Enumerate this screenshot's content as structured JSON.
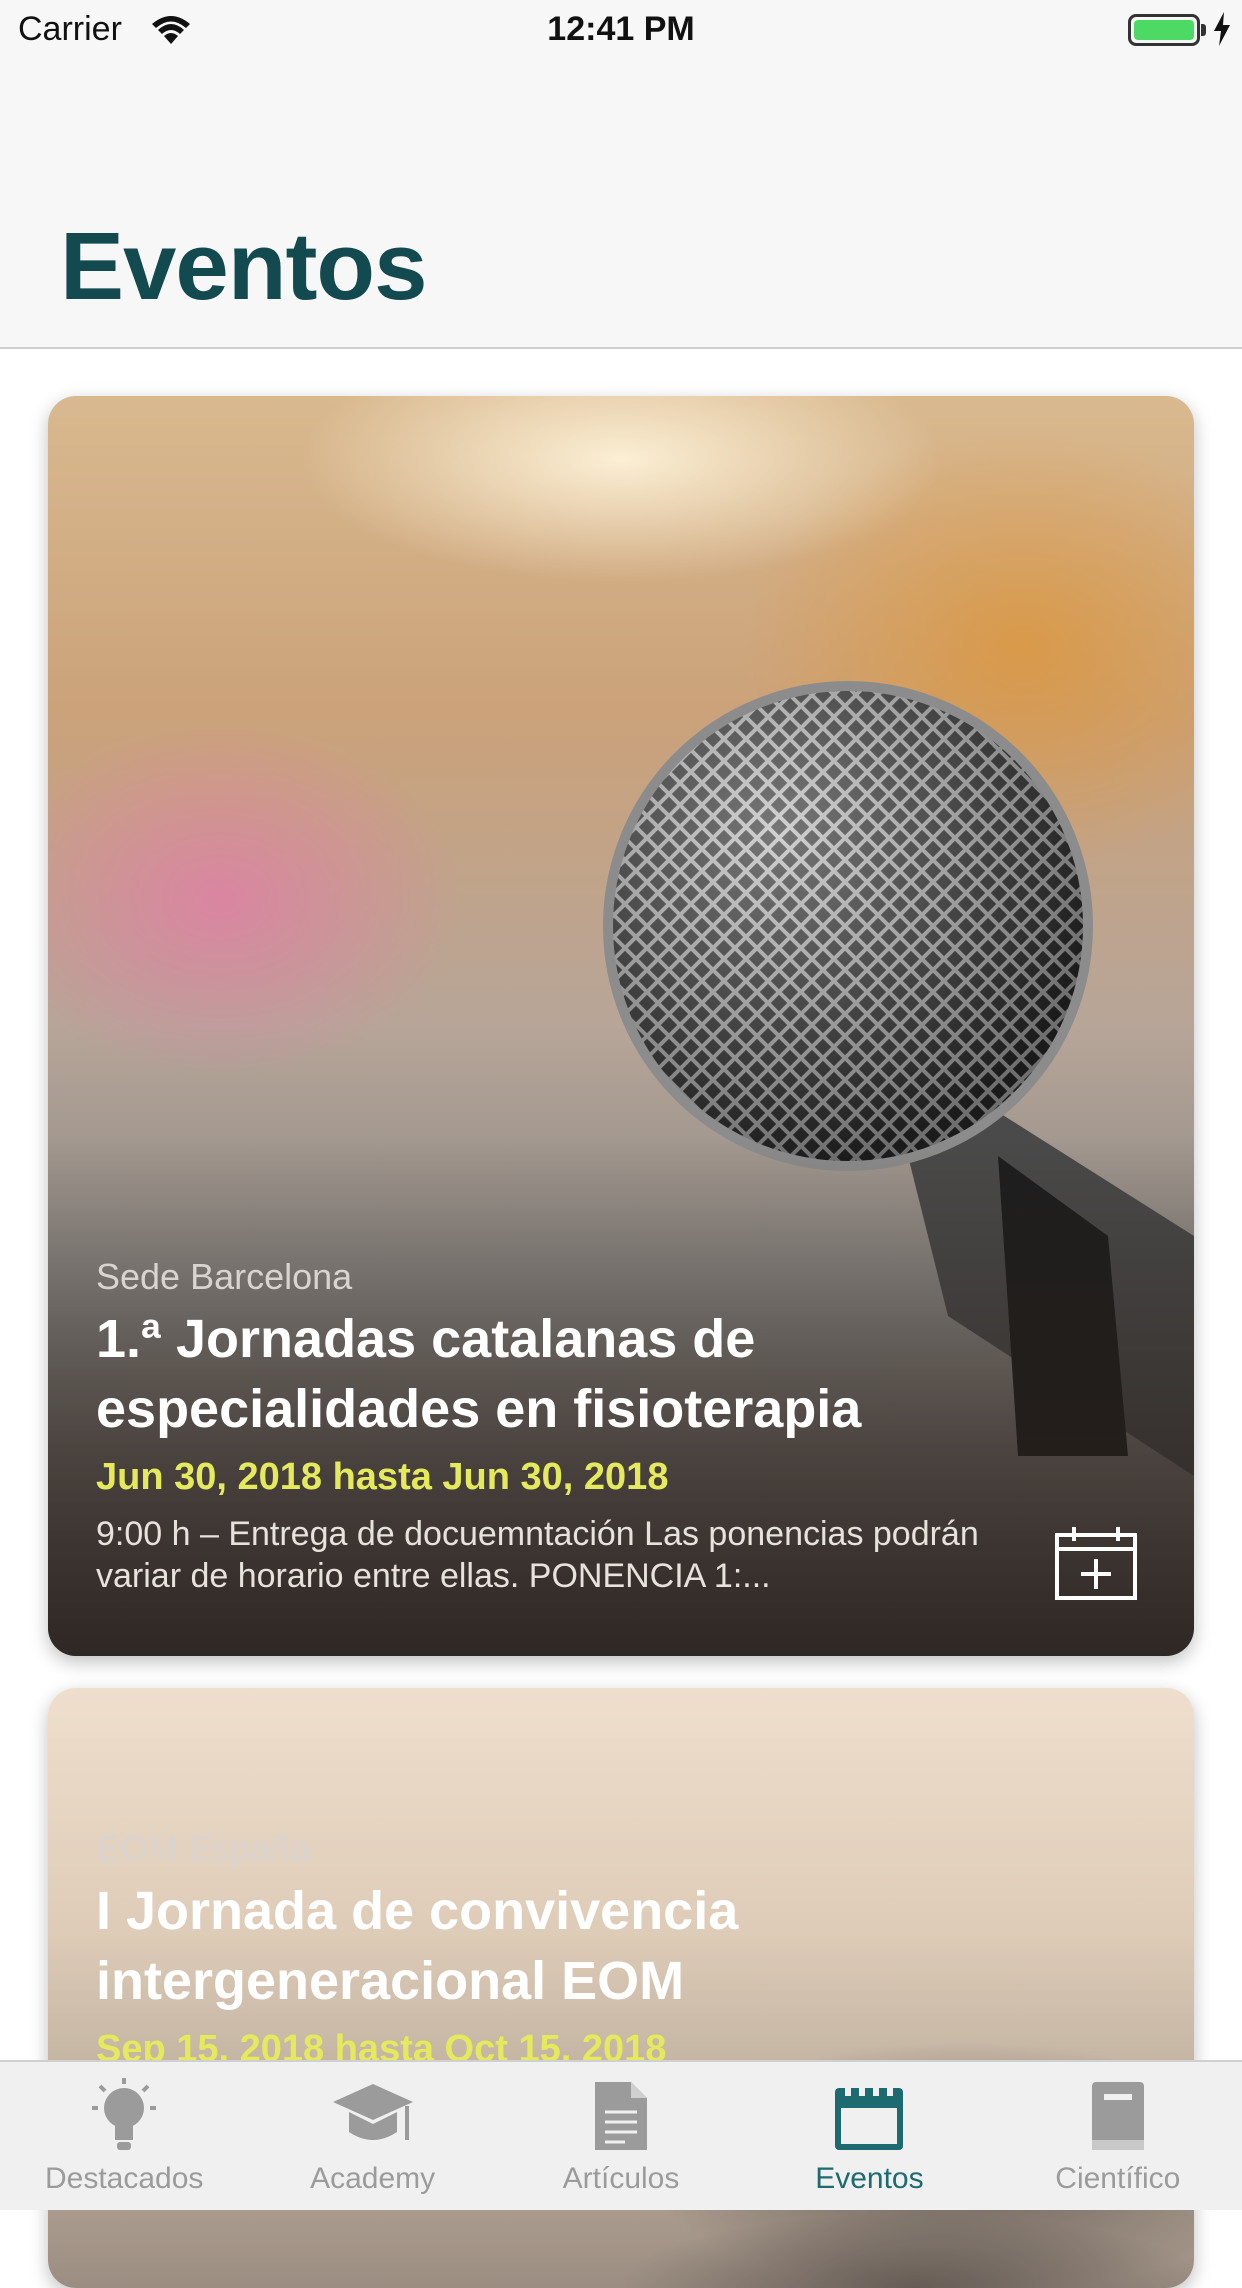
{
  "status_bar": {
    "carrier": "Carrier",
    "time": "12:41 PM"
  },
  "header": {
    "title": "Eventos"
  },
  "events": [
    {
      "location": "Sede Barcelona",
      "title": "1.ª Jornadas catalanas de especialidades en fisioterapia",
      "dates": "Jun 30, 2018 hasta Jun 30, 2018",
      "description": "9:00 h –  Entrega de docuemntación Las ponencias podrán variar de horario entre ellas. PONENCIA 1:..."
    },
    {
      "location": "EOM España",
      "title": "I Jornada de convivencia intergeneracional EOM",
      "dates": "Sep 15, 2018 hasta Oct 15, 2018"
    }
  ],
  "tabs": [
    {
      "label": "Destacados",
      "icon": "lightbulb-icon",
      "active": false
    },
    {
      "label": "Academy",
      "icon": "graduation-cap-icon",
      "active": false
    },
    {
      "label": "Artículos",
      "icon": "document-icon",
      "active": false
    },
    {
      "label": "Eventos",
      "icon": "calendar-icon",
      "active": true
    },
    {
      "label": "Científico",
      "icon": "book-icon",
      "active": false
    }
  ],
  "colors": {
    "accent": "#1d6a70",
    "title": "#124a4f",
    "date": "#e4ea5c",
    "inactive": "#9b9b9b"
  }
}
